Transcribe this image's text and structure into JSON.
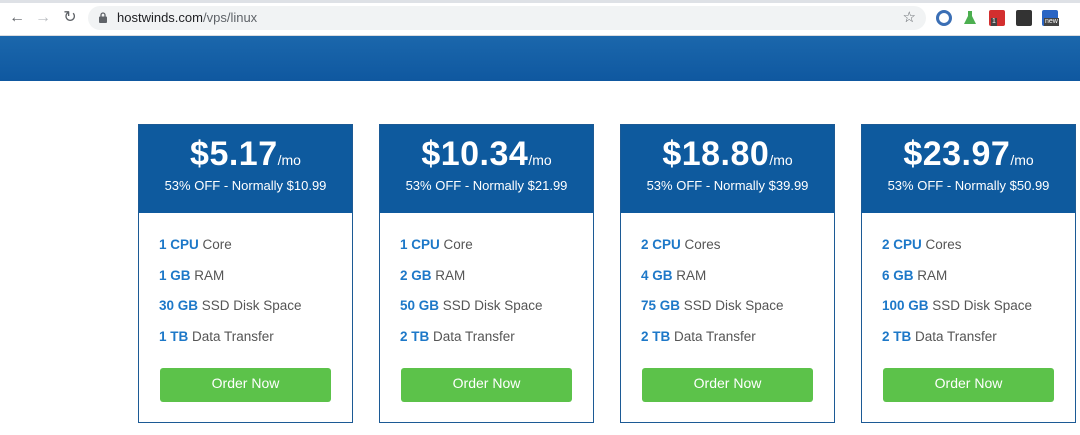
{
  "browser": {
    "url_host": "hostwinds.com",
    "url_path": "/vps/linux",
    "extensions": [
      {
        "name": "dashboard-ext-icon",
        "color": "#3b6fb5"
      },
      {
        "name": "flask-ext-icon",
        "color": "#4caf50"
      },
      {
        "name": "todo-ext-icon",
        "color": "#d32f2f",
        "badge": "1"
      },
      {
        "name": "m-ext-icon",
        "color": "#333333"
      },
      {
        "name": "new-ext-icon",
        "color": "#2a65c4",
        "badge": "new"
      }
    ]
  },
  "colors": {
    "banner": "#0e5a9e",
    "price_header": "#0e5a9e",
    "highlight": "#1d78c8",
    "order_button": "#5cc24a"
  },
  "plans": [
    {
      "price": "$5.17",
      "per": "/mo",
      "discount": "53% OFF - Normally $10.99",
      "features": [
        {
          "value": "1 CPU",
          "label": " Core"
        },
        {
          "value": "1 GB",
          "label": " RAM"
        },
        {
          "value": "30 GB",
          "label": " SSD Disk Space"
        },
        {
          "value": "1 TB",
          "label": " Data Transfer"
        }
      ],
      "button": "Order Now"
    },
    {
      "price": "$10.34",
      "per": "/mo",
      "discount": "53% OFF - Normally $21.99",
      "features": [
        {
          "value": "1 CPU",
          "label": " Core"
        },
        {
          "value": "2 GB",
          "label": " RAM"
        },
        {
          "value": "50 GB",
          "label": " SSD Disk Space"
        },
        {
          "value": "2 TB",
          "label": " Data Transfer"
        }
      ],
      "button": "Order Now"
    },
    {
      "price": "$18.80",
      "per": "/mo",
      "discount": "53% OFF - Normally $39.99",
      "features": [
        {
          "value": "2 CPU",
          "label": " Cores"
        },
        {
          "value": "4 GB",
          "label": " RAM"
        },
        {
          "value": "75 GB",
          "label": " SSD Disk Space"
        },
        {
          "value": "2 TB",
          "label": " Data Transfer"
        }
      ],
      "button": "Order Now"
    },
    {
      "price": "$23.97",
      "per": "/mo",
      "discount": "53% OFF - Normally $50.99",
      "features": [
        {
          "value": "2 CPU",
          "label": " Cores"
        },
        {
          "value": "6 GB",
          "label": " RAM"
        },
        {
          "value": "100 GB",
          "label": " SSD Disk Space"
        },
        {
          "value": "2 TB",
          "label": " Data Transfer"
        }
      ],
      "button": "Order Now"
    }
  ]
}
